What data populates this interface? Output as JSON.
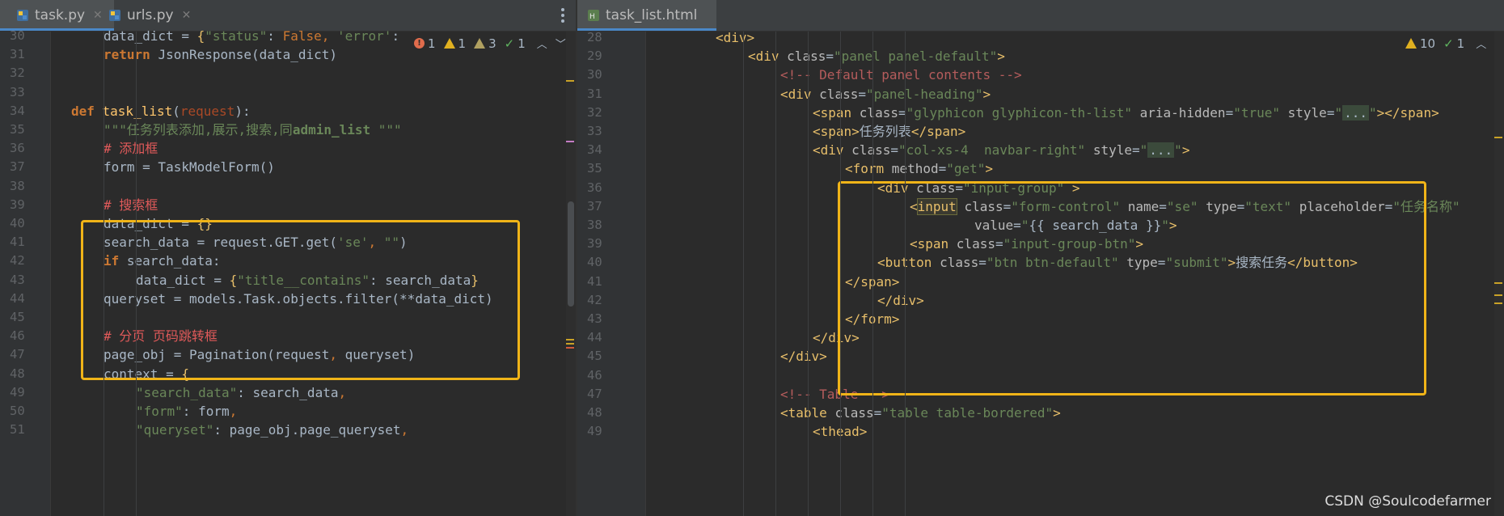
{
  "left_pane": {
    "tabs": [
      {
        "label": "task.py",
        "icon": "python-file-icon",
        "active": true
      },
      {
        "label": "urls.py",
        "icon": "python-file-icon",
        "active": false
      }
    ],
    "inspection": {
      "errors": "1",
      "warnings": "1",
      "weak_warnings": "3",
      "ok": "1"
    },
    "lines": [
      {
        "n": "30",
        "indent": 1,
        "tokens": [
          [
            "",
            "data_dict = "
          ],
          [
            "brace",
            "{"
          ],
          [
            "str",
            "\"status\""
          ],
          [
            "",
            ": "
          ],
          [
            "kwn",
            "False"
          ],
          [
            "punc",
            ", "
          ],
          [
            "str",
            "'error'"
          ],
          [
            "",
            ": "
          ]
        ]
      },
      {
        "n": "31",
        "indent": 1,
        "tokens": [
          [
            "kw",
            "return "
          ],
          [
            "",
            "JsonResponse(data_dict)"
          ]
        ]
      },
      {
        "n": "32",
        "indent": 0,
        "tokens": []
      },
      {
        "n": "33",
        "indent": 0,
        "tokens": []
      },
      {
        "n": "34",
        "indent": 0,
        "tokens": [
          [
            "kw",
            "def "
          ],
          [
            "fn",
            "task_list"
          ],
          [
            "",
            "("
          ],
          [
            "par",
            "request"
          ],
          [
            "",
            "):"
          ]
        ]
      },
      {
        "n": "35",
        "indent": 1,
        "tokens": [
          [
            "str",
            "\"\"\"任务列表添加,展示,搜索,同"
          ],
          [
            "strb",
            "admin_list"
          ],
          [
            "str",
            " \"\"\""
          ]
        ]
      },
      {
        "n": "36",
        "indent": 1,
        "tokens": [
          [
            "cm",
            "# 添加框"
          ]
        ]
      },
      {
        "n": "37",
        "indent": 1,
        "tokens": [
          [
            "",
            "form = TaskModelForm()"
          ]
        ]
      },
      {
        "n": "38",
        "indent": 0,
        "tokens": []
      },
      {
        "n": "39",
        "indent": 1,
        "tokens": [
          [
            "cm",
            "# 搜索框"
          ]
        ]
      },
      {
        "n": "40",
        "indent": 1,
        "tokens": [
          [
            "",
            "data_dict = "
          ],
          [
            "brace",
            "{}"
          ]
        ]
      },
      {
        "n": "41",
        "indent": 1,
        "tokens": [
          [
            "",
            "search_data = request.GET.get("
          ],
          [
            "str",
            "'se'"
          ],
          [
            "punc",
            ", "
          ],
          [
            "str",
            "\"\""
          ],
          [
            "",
            ")"
          ]
        ]
      },
      {
        "n": "42",
        "indent": 1,
        "tokens": [
          [
            "kw",
            "if "
          ],
          [
            "",
            "search_data:"
          ]
        ]
      },
      {
        "n": "43",
        "indent": 2,
        "tokens": [
          [
            "",
            "data_dict = "
          ],
          [
            "brace",
            "{"
          ],
          [
            "str",
            "\"title__contains\""
          ],
          [
            "",
            ": search_data"
          ],
          [
            "brace",
            "}"
          ]
        ]
      },
      {
        "n": "44",
        "indent": 1,
        "tokens": [
          [
            "",
            "queryset = models.Task.objects.filter(**data_dict)"
          ]
        ]
      },
      {
        "n": "45",
        "indent": 0,
        "tokens": []
      },
      {
        "n": "46",
        "indent": 1,
        "tokens": [
          [
            "cm",
            "# 分页 页码跳转框"
          ]
        ]
      },
      {
        "n": "47",
        "indent": 1,
        "tokens": [
          [
            "",
            "page_obj = Pagination(request"
          ],
          [
            "punc",
            ", "
          ],
          [
            "",
            "queryset)"
          ]
        ]
      },
      {
        "n": "48",
        "indent": 1,
        "tokens": [
          [
            "",
            "context = "
          ],
          [
            "brace",
            "{"
          ]
        ]
      },
      {
        "n": "49",
        "indent": 2,
        "tokens": [
          [
            "str",
            "\"search_data\""
          ],
          [
            "",
            ": search_data"
          ],
          [
            "punc",
            ","
          ]
        ]
      },
      {
        "n": "50",
        "indent": 2,
        "tokens": [
          [
            "str",
            "\"form\""
          ],
          [
            "",
            ": form"
          ],
          [
            "punc",
            ","
          ]
        ]
      },
      {
        "n": "51",
        "indent": 2,
        "tokens": [
          [
            "str",
            "\"queryset\""
          ],
          [
            "",
            ": page_obj.page_queryset"
          ],
          [
            "punc",
            ","
          ]
        ]
      }
    ]
  },
  "right_pane": {
    "tabs": [
      {
        "label": "task_list.html",
        "icon": "html-file-icon",
        "active": true
      }
    ],
    "inspection": {
      "warnings": "10",
      "ok": "1"
    },
    "lines": [
      {
        "n": "28",
        "indent": 0,
        "tokens": [
          [
            "tag",
            "<div>"
          ]
        ]
      },
      {
        "n": "29",
        "indent": 1,
        "tokens": [
          [
            "tag",
            "<div "
          ],
          [
            "attr",
            "class"
          ],
          [
            "",
            "="
          ],
          [
            "aval",
            "\"panel panel-default\""
          ],
          [
            "tag",
            ">"
          ]
        ]
      },
      {
        "n": "30",
        "indent": 2,
        "tokens": [
          [
            "hcom",
            "<!-- Default panel contents -->"
          ]
        ]
      },
      {
        "n": "31",
        "indent": 2,
        "tokens": [
          [
            "tag",
            "<div "
          ],
          [
            "attr",
            "class"
          ],
          [
            "",
            "="
          ],
          [
            "aval",
            "\"panel-heading\""
          ],
          [
            "tag",
            ">"
          ]
        ]
      },
      {
        "n": "32",
        "indent": 3,
        "tokens": [
          [
            "tag",
            "<span "
          ],
          [
            "attr",
            "class"
          ],
          [
            "",
            "="
          ],
          [
            "aval",
            "\"glyphicon glyphicon-th-list\" "
          ],
          [
            "attr",
            "aria-hidden"
          ],
          [
            "",
            "="
          ],
          [
            "aval",
            "\"true\" "
          ],
          [
            "attr",
            "style"
          ],
          [
            "",
            "="
          ],
          [
            "aval",
            "\""
          ],
          [
            "dot3",
            "..."
          ],
          [
            "aval",
            "\""
          ],
          [
            "tag",
            "></span>"
          ]
        ]
      },
      {
        "n": "33",
        "indent": 3,
        "tokens": [
          [
            "tag",
            "<span>"
          ],
          [
            "",
            "任务列表"
          ],
          [
            "tag",
            "</span>"
          ]
        ]
      },
      {
        "n": "34",
        "indent": 3,
        "tokens": [
          [
            "tag",
            "<div "
          ],
          [
            "attr",
            "class"
          ],
          [
            "",
            "="
          ],
          [
            "aval",
            "\"col-xs-4  navbar-right\" "
          ],
          [
            "attr",
            "style"
          ],
          [
            "",
            "="
          ],
          [
            "aval",
            "\""
          ],
          [
            "dot3",
            "..."
          ],
          [
            "aval",
            "\""
          ],
          [
            "tag",
            ">"
          ]
        ]
      },
      {
        "n": "35",
        "indent": 4,
        "tokens": [
          [
            "tag",
            "<form "
          ],
          [
            "attr",
            "method"
          ],
          [
            "",
            "="
          ],
          [
            "aval",
            "\"get\""
          ],
          [
            "tag",
            ">"
          ]
        ]
      },
      {
        "n": "36",
        "indent": 5,
        "tokens": [
          [
            "tag",
            "<div "
          ],
          [
            "attr",
            "class"
          ],
          [
            "",
            "="
          ],
          [
            "aval",
            "\"input-group\" "
          ],
          [
            "tag",
            ">"
          ]
        ]
      },
      {
        "n": "37",
        "indent": 6,
        "tokens": [
          [
            "tag",
            "<"
          ],
          [
            "tagb",
            "input"
          ],
          [
            "attr",
            " class"
          ],
          [
            "",
            "="
          ],
          [
            "aval",
            "\"form-control\" "
          ],
          [
            "attr",
            "name"
          ],
          [
            "",
            "="
          ],
          [
            "aval",
            "\"se\" "
          ],
          [
            "attr",
            "type"
          ],
          [
            "",
            "="
          ],
          [
            "aval",
            "\"text\" "
          ],
          [
            "attr",
            "placeholder"
          ],
          [
            "",
            "="
          ],
          [
            "aval",
            "\"任务名称\""
          ]
        ]
      },
      {
        "n": "38",
        "indent": 8,
        "tokens": [
          [
            "attr",
            "value"
          ],
          [
            "",
            "="
          ],
          [
            "aval",
            "\""
          ],
          [
            "",
            "{{ search_data }}"
          ],
          [
            "aval",
            "\""
          ],
          [
            "tag",
            ">"
          ]
        ]
      },
      {
        "n": "39",
        "indent": 6,
        "tokens": [
          [
            "tag",
            "<span "
          ],
          [
            "attr",
            "class"
          ],
          [
            "",
            "="
          ],
          [
            "aval",
            "\"input-group-btn\""
          ],
          [
            "tag",
            ">"
          ]
        ]
      },
      {
        "n": "40",
        "indent": 5,
        "tokens": [
          [
            "tag",
            "<button "
          ],
          [
            "attr",
            "class"
          ],
          [
            "",
            "="
          ],
          [
            "aval",
            "\"btn btn-default\" "
          ],
          [
            "attr",
            "type"
          ],
          [
            "",
            "="
          ],
          [
            "aval",
            "\"submit\""
          ],
          [
            "tag",
            ">"
          ],
          [
            "",
            "搜索任务"
          ],
          [
            "tag",
            "</button>"
          ]
        ]
      },
      {
        "n": "41",
        "indent": 4,
        "tokens": [
          [
            "tag",
            "</span>"
          ]
        ]
      },
      {
        "n": "42",
        "indent": 5,
        "tokens": [
          [
            "tag",
            "</div>"
          ]
        ]
      },
      {
        "n": "43",
        "indent": 4,
        "tokens": [
          [
            "tag",
            "</form>"
          ]
        ]
      },
      {
        "n": "44",
        "indent": 3,
        "tokens": [
          [
            "tag",
            "</div>"
          ]
        ]
      },
      {
        "n": "45",
        "indent": 2,
        "tokens": [
          [
            "tag",
            "</div>"
          ]
        ]
      },
      {
        "n": "46",
        "indent": 0,
        "tokens": []
      },
      {
        "n": "47",
        "indent": 2,
        "tokens": [
          [
            "hcom",
            "<!-- Table -->"
          ]
        ]
      },
      {
        "n": "48",
        "indent": 2,
        "tokens": [
          [
            "tag",
            "<table "
          ],
          [
            "attr",
            "class"
          ],
          [
            "",
            "="
          ],
          [
            "aval",
            "\"table table-bordered\""
          ],
          [
            "tag",
            ">"
          ]
        ]
      },
      {
        "n": "49",
        "indent": 3,
        "tokens": [
          [
            "tag",
            "<thead>"
          ]
        ]
      }
    ]
  },
  "watermark": "CSDN @Soulcodefarmer",
  "colors": {
    "highlight_box": "#f0b418",
    "background": "#2b2b2b",
    "active_tab_underline": "#4a88c7"
  }
}
